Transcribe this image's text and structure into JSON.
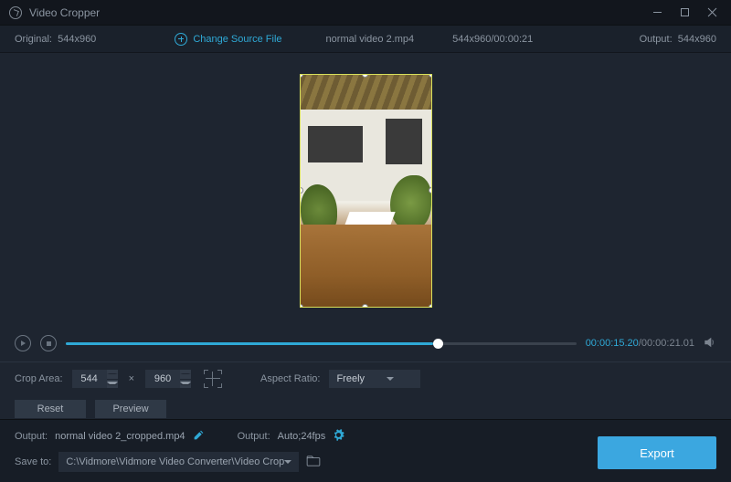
{
  "titlebar": {
    "title": "Video Cropper"
  },
  "subbar": {
    "original_label": "Original:",
    "original_dims": "544x960",
    "change_source_label": "Change Source File",
    "filename": "normal video 2.mp4",
    "source_dims_time": "544x960/00:00:21",
    "output_label": "Output:",
    "output_dims": "544x960"
  },
  "playback": {
    "current_time": "00:00:15.20",
    "duration": "00:00:21.01"
  },
  "crop": {
    "area_label": "Crop Area:",
    "width": "544",
    "height": "960",
    "aspect_label": "Aspect Ratio:",
    "aspect_value": "Freely"
  },
  "buttons": {
    "reset": "Reset",
    "preview": "Preview",
    "export": "Export"
  },
  "output": {
    "label": "Output:",
    "filename": "normal video 2_cropped.mp4",
    "fmt_label": "Output:",
    "fmt_value": "Auto;24fps",
    "saveto_label": "Save to:",
    "saveto_path": "C:\\Vidmore\\Vidmore Video Converter\\Video Crop"
  }
}
